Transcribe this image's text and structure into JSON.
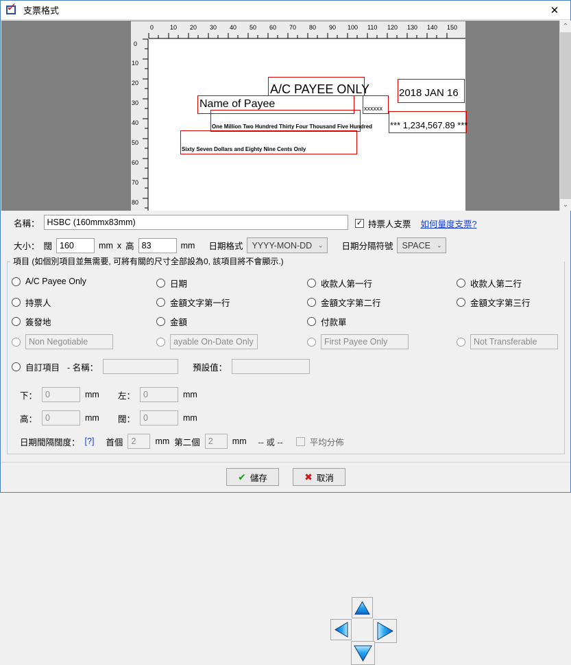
{
  "window": {
    "title": "支票格式",
    "icon": "check-document-icon",
    "close_label": "✕"
  },
  "preview": {
    "ruler_h_labels": [
      "0",
      "10",
      "20",
      "30",
      "40",
      "50",
      "60",
      "70",
      "80",
      "90",
      "100",
      "110",
      "120",
      "130",
      "140",
      "150"
    ],
    "ruler_v_labels": [
      "0",
      "10",
      "20",
      "30",
      "40",
      "50",
      "60",
      "70",
      "80"
    ],
    "fields": [
      {
        "name": "ac-payee-only",
        "text": "A/C PAYEE ONLY"
      },
      {
        "name": "date",
        "text": "2018 JAN 16"
      },
      {
        "name": "payee-line-1",
        "text": "Name of Payee"
      },
      {
        "name": "bearer",
        "text": "xxxxxx"
      },
      {
        "name": "amount-words-line-1",
        "text": "One Million Two Hundred Thirty Four Thousand Five Hundred"
      },
      {
        "name": "amount-words-line-2",
        "text": "Sixty Seven Dollars and Eighty Nine Cents Only"
      },
      {
        "name": "amount-figures",
        "text": "*** 1,234,567.89 ***"
      }
    ],
    "scrollbar": {
      "up": "⌃",
      "down": "⌄"
    }
  },
  "form": {
    "name_label": "名稱：",
    "name_value": "HSBC (160mmx83mm)",
    "bearer_checkbox": {
      "label": "持票人支票",
      "checked": true,
      "mark": "✓"
    },
    "help_link": "如何量度支票?",
    "size_label": "大小：",
    "width_label": "闊",
    "width_value": "160",
    "unit_mm": "mm",
    "times": "x",
    "height_label": "高",
    "height_value": "83",
    "date_format_label": "日期格式",
    "date_format_value": "YYYY-MON-DD",
    "date_separator_label": "日期分隔符號",
    "date_separator_value": "SPACE",
    "chevron": "⌄"
  },
  "items_group": {
    "title": "項目 (如個別項目並無需要, 可將有關的尺寸全部設為0, 該項目將不會顯示.)",
    "radios": [
      {
        "label": "A/C Payee Only",
        "col": 1,
        "row": 1
      },
      {
        "label": "日期",
        "col": 2,
        "row": 1
      },
      {
        "label": "收款人第一行",
        "col": 3,
        "row": 1
      },
      {
        "label": "收款人第二行",
        "col": 4,
        "row": 1
      },
      {
        "label": "持票人",
        "col": 1,
        "row": 2
      },
      {
        "label": "金額文字第一行",
        "col": 2,
        "row": 2
      },
      {
        "label": "金額文字第二行",
        "col": 3,
        "row": 2
      },
      {
        "label": "金額文字第三行",
        "col": 4,
        "row": 2
      },
      {
        "label": "簽發地",
        "col": 1,
        "row": 3
      },
      {
        "label": "金額",
        "col": 2,
        "row": 3
      },
      {
        "label": "付款單",
        "col": 3,
        "row": 3
      }
    ],
    "text_radios": [
      {
        "name": "non-negotiable",
        "placeholder": "Non Negotiable"
      },
      {
        "name": "payable-on-date-only",
        "placeholder": "ayable On-Date Only"
      },
      {
        "name": "first-payee-only",
        "placeholder": "First Payee Only"
      },
      {
        "name": "not-transferable",
        "placeholder": "Not Transferable"
      }
    ],
    "custom_item": {
      "radio_label": "自訂項目",
      "name_label": "- 名稱：",
      "name_value": "",
      "default_label": "預設值：",
      "default_value": ""
    },
    "dimensions": {
      "bottom_label": "下：",
      "bottom_value": "0",
      "left_label": "左：",
      "left_value": "0",
      "height_label": "高：",
      "height_value": "0",
      "width_label": "闊：",
      "width_value": "0",
      "unit": "mm"
    },
    "date_spacing": {
      "label": "日期間隔闊度：",
      "help": "[?]",
      "first_label": "首個",
      "first_value": "2",
      "second_label": "第二個",
      "second_value": "2",
      "unit": "mm",
      "or_label": "-- 或 --",
      "even_label": "平均分佈",
      "even_checked": false
    },
    "arrows": {
      "up": "up-arrow",
      "down": "down-arrow",
      "left": "left-arrow",
      "right": "right-arrow"
    }
  },
  "footer": {
    "save_label": "儲存",
    "save_icon": "✔",
    "cancel_label": "取消",
    "cancel_icon": "✖"
  }
}
